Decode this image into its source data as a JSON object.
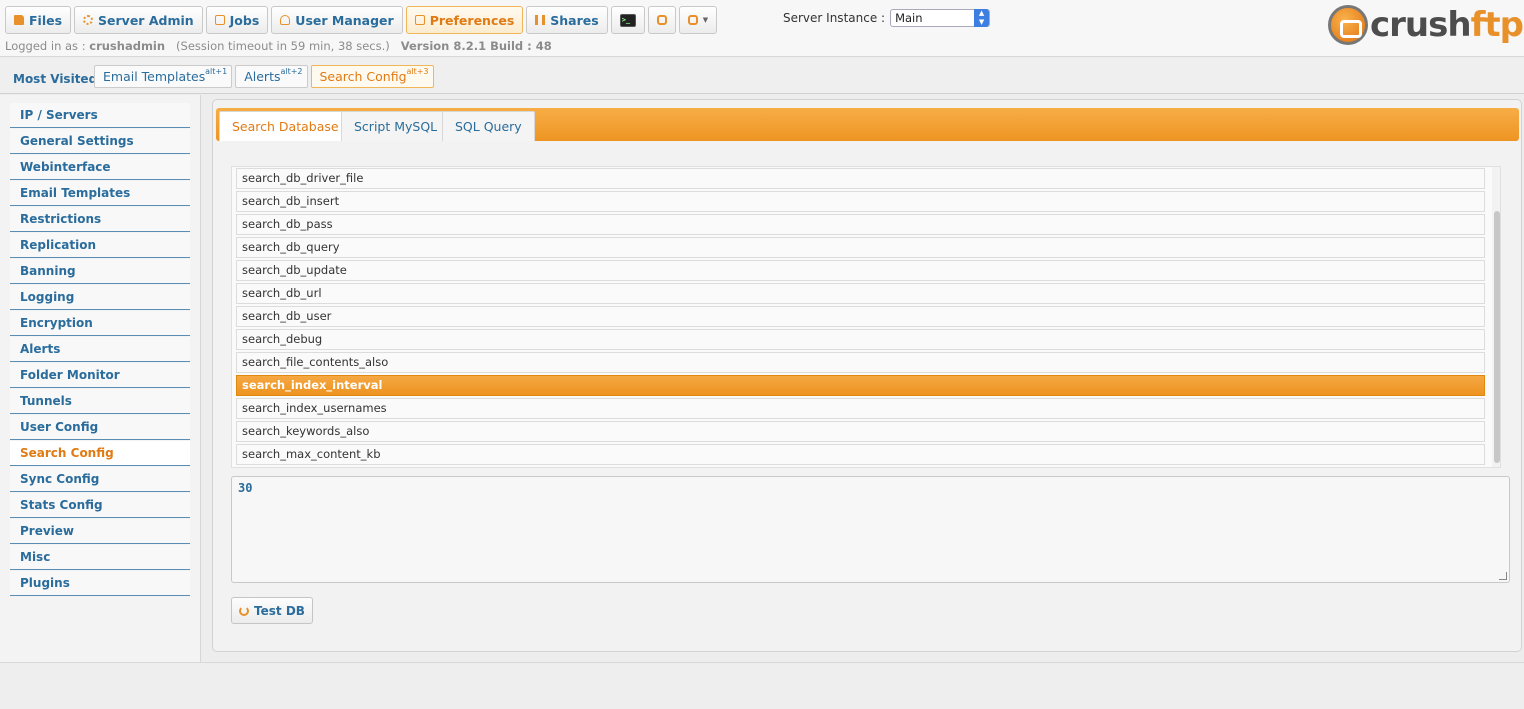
{
  "topnav": {
    "items": [
      {
        "label": "Files",
        "icon": "folder-icon"
      },
      {
        "label": "Server Admin",
        "icon": "gear-icon"
      },
      {
        "label": "Jobs",
        "icon": "jobs-icon"
      },
      {
        "label": "User Manager",
        "icon": "user-icon"
      },
      {
        "label": "Preferences",
        "icon": "preferences-icon",
        "active": true
      },
      {
        "label": "Shares",
        "icon": "shares-icon"
      }
    ],
    "terminal_glyph": ">_"
  },
  "session": {
    "logged_in_label": "Logged in as :",
    "username": "crushadmin",
    "timeout": "(Session timeout in 59 min, 38 secs.)",
    "version": "Version 8.2.1 Build : 48"
  },
  "instance": {
    "label": "Server Instance :",
    "value": "Main"
  },
  "logo": {
    "text_dark": "crush",
    "text_accent": "ftp"
  },
  "most_visited": {
    "label": "Most Visited :",
    "items": [
      {
        "label": "Email Templates",
        "shortcut": "alt+1"
      },
      {
        "label": "Alerts",
        "shortcut": "alt+2"
      },
      {
        "label": "Search Config",
        "shortcut": "alt+3",
        "active": true
      }
    ]
  },
  "sidebar": {
    "items": [
      {
        "label": "IP / Servers"
      },
      {
        "label": "General Settings"
      },
      {
        "label": "Webinterface"
      },
      {
        "label": "Email Templates"
      },
      {
        "label": "Restrictions"
      },
      {
        "label": "Replication"
      },
      {
        "label": "Banning"
      },
      {
        "label": "Logging"
      },
      {
        "label": "Encryption"
      },
      {
        "label": "Alerts"
      },
      {
        "label": "Folder Monitor"
      },
      {
        "label": "Tunnels"
      },
      {
        "label": "User Config"
      },
      {
        "label": "Search Config",
        "active": true
      },
      {
        "label": "Sync Config"
      },
      {
        "label": "Stats Config"
      },
      {
        "label": "Preview"
      },
      {
        "label": "Misc"
      },
      {
        "label": "Plugins"
      }
    ]
  },
  "tabs": [
    {
      "label": "Search Database",
      "active": true
    },
    {
      "label": "Script MySQL"
    },
    {
      "label": "SQL Query"
    }
  ],
  "list": {
    "items": [
      "search_db_driver_file",
      "search_db_insert",
      "search_db_pass",
      "search_db_query",
      "search_db_update",
      "search_db_url",
      "search_db_user",
      "search_debug",
      "search_file_contents_also",
      "search_index_interval",
      "search_index_usernames",
      "search_keywords_also",
      "search_max_content_kb"
    ],
    "selected": "search_index_interval"
  },
  "value": "30",
  "buttons": {
    "test_db": "Test DB"
  },
  "colors": {
    "accent": "#ee9523",
    "link": "#2a6c9c"
  }
}
